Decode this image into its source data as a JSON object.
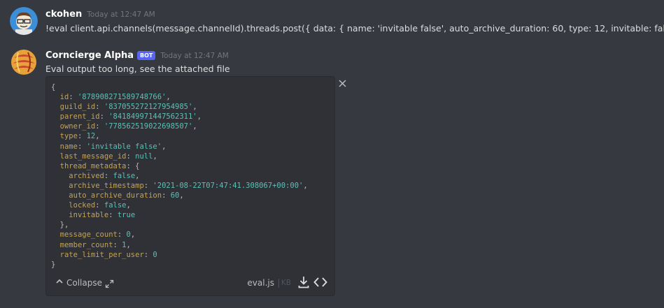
{
  "messages": [
    {
      "author": "ckohen",
      "timestamp": "Today at 12:47 AM",
      "content": "!eval client.api.channels(message.channelId).threads.post({ data: { name: 'invitable false', auto_archive_duration: 60, type: 12, invitable: false }})"
    },
    {
      "author": "Corncierge Alpha",
      "bot_tag": "BOT",
      "timestamp": "Today at 12:47 AM",
      "content": "Eval output too long, see the attached file"
    }
  ],
  "attachment": {
    "code_lines": [
      "{",
      "  id: '878908271589748766',",
      "  guild_id: '837055272127954985',",
      "  parent_id: '841849971447562311',",
      "  owner_id: '778562519022698507',",
      "  type: 12,",
      "  name: 'invitable false',",
      "  last_message_id: null,",
      "  thread_metadata: {",
      "    archived: false,",
      "    archive_timestamp: '2021-08-22T07:47:41.308067+00:00',",
      "    auto_archive_duration: 60,",
      "    locked: false,",
      "    invitable: true",
      "  },",
      "  message_count: 0,",
      "  member_count: 1,",
      "  rate_limit_per_user: 0",
      "}"
    ],
    "collapse_label": "Collapse",
    "file_name": "eval.js",
    "file_size": "KB",
    "icons": {
      "collapse": "chevron-up-icon",
      "expand": "expand-arrows-icon",
      "download": "download-icon",
      "view_code": "code-brackets-icon",
      "close": "close-icon"
    }
  },
  "colors": {
    "background": "#36393f",
    "embed_background": "#2f3136",
    "bot_tag": "#5865f2",
    "code_key": "#c2a35a",
    "code_value": "#5bc0b6"
  }
}
